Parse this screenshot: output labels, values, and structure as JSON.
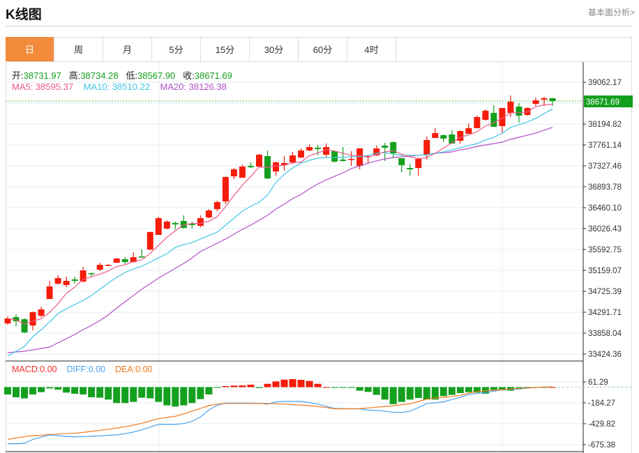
{
  "header": {
    "title": "K线图",
    "more_link": "基本面分析>"
  },
  "tabs": [
    {
      "label": "日",
      "active": true
    },
    {
      "label": "周"
    },
    {
      "label": "月"
    },
    {
      "label": "5分"
    },
    {
      "label": "15分"
    },
    {
      "label": "30分"
    },
    {
      "label": "60分"
    },
    {
      "label": "4时"
    }
  ],
  "ohlc_legend": {
    "open_label": "开:",
    "open": "38731.97",
    "high_label": "高:",
    "high": "38734.28",
    "low_label": "低:",
    "low": "38567.90",
    "close_label": "收:",
    "close": "38671.69"
  },
  "ma_legend": {
    "ma5": "MA5: 38595.37",
    "ma10": "MA10: 38510.22",
    "ma20": "MA20: 38126.38"
  },
  "macd_legend": {
    "macd": "MACD:0.00",
    "diff": "DIFF:0.00",
    "dea": "DEA:0.00"
  },
  "colors": {
    "up": "#f51c0a",
    "down": "#14a01e",
    "ma5": "#ea5a86",
    "ma10": "#3fc6e0",
    "ma20": "#b050c8",
    "diff": "#4aa3f0",
    "dea": "#f07a1e",
    "macd_label": "#f0302a",
    "accent": "#f28c3c"
  },
  "chart_data": [
    {
      "type": "candlestick",
      "current_price": "38671.69",
      "ylim": [
        33424.36,
        39062.17
      ],
      "y_ticks": [
        "39062.17",
        "38194.82",
        "37761.14",
        "37327.46",
        "36893.78",
        "36460.10",
        "36026.43",
        "35592.75",
        "35159.07",
        "34725.39",
        "34291.71",
        "33858.04",
        "33424.36"
      ],
      "y_tick_values": [
        39062.17,
        38194.82,
        37761.14,
        37327.46,
        36893.78,
        36460.1,
        36026.43,
        35592.75,
        35159.07,
        34725.39,
        34291.71,
        33858.04,
        33424.36
      ],
      "candles_ochl_order": "open,close,high,low",
      "candles": [
        [
          34060,
          34162,
          34205,
          34031
        ],
        [
          34190,
          34104,
          34248,
          34002
        ],
        [
          34147,
          33872,
          34162,
          33858
        ],
        [
          34017,
          34292,
          34306,
          33916
        ],
        [
          34219,
          34350,
          34407,
          34190
        ],
        [
          34566,
          34826,
          34942,
          34566
        ],
        [
          34884,
          35000,
          35058,
          34870
        ],
        [
          34856,
          34942,
          35029,
          34812
        ],
        [
          34971,
          34942,
          35029,
          34884
        ],
        [
          34928,
          35159,
          35231,
          34913
        ],
        [
          35101,
          35087,
          35116,
          35029
        ],
        [
          35174,
          35275,
          35318,
          35145
        ],
        [
          35260,
          35275,
          35289,
          35246
        ],
        [
          35318,
          35405,
          35419,
          35318
        ],
        [
          35390,
          35332,
          35434,
          35289
        ],
        [
          35332,
          35434,
          35535,
          35318
        ],
        [
          35448,
          35434,
          35593,
          35419
        ],
        [
          35592,
          35954,
          35968,
          35578
        ],
        [
          35896,
          36243,
          36272,
          35896
        ],
        [
          36026,
          36171,
          36200,
          36012
        ],
        [
          36142,
          36113,
          36171,
          36012
        ],
        [
          36185,
          36041,
          36301,
          36026
        ],
        [
          36128,
          36099,
          36171,
          36026
        ],
        [
          36084,
          36243,
          36301,
          36055
        ],
        [
          36257,
          36402,
          36431,
          36243
        ],
        [
          36431,
          36576,
          36605,
          36388
        ],
        [
          36590,
          37096,
          37111,
          36532
        ],
        [
          37111,
          37255,
          37284,
          37053
        ],
        [
          37082,
          37313,
          37356,
          37082
        ],
        [
          37327,
          37299,
          37400,
          37284
        ],
        [
          37313,
          37559,
          37574,
          37299
        ],
        [
          37530,
          37067,
          37646,
          37053
        ],
        [
          37212,
          37400,
          37415,
          37125
        ],
        [
          37342,
          37386,
          37530,
          37226
        ],
        [
          37400,
          37545,
          37617,
          37371
        ],
        [
          37501,
          37646,
          37690,
          37487
        ],
        [
          37646,
          37718,
          37776,
          37631
        ],
        [
          37704,
          37675,
          37762,
          37545
        ],
        [
          37559,
          37718,
          37791,
          37516
        ],
        [
          37631,
          37415,
          37646,
          37400
        ],
        [
          37458,
          37429,
          37718,
          37415
        ],
        [
          37458,
          37472,
          37631,
          37327
        ],
        [
          37327,
          37690,
          37690,
          37255
        ],
        [
          37516,
          37530,
          37559,
          37371
        ],
        [
          37545,
          37690,
          37747,
          37530
        ],
        [
          37747,
          37704,
          37805,
          37429
        ],
        [
          37819,
          37588,
          37834,
          37487
        ],
        [
          37487,
          37342,
          37487,
          37197
        ],
        [
          37284,
          37255,
          37371,
          37125
        ],
        [
          37284,
          37472,
          37501,
          37125
        ],
        [
          37559,
          37863,
          37935,
          37458
        ],
        [
          37906,
          38007,
          38109,
          37906
        ],
        [
          37964,
          37892,
          37978,
          37819
        ],
        [
          37978,
          37790,
          38065,
          37790
        ],
        [
          37848,
          38050,
          38065,
          37790
        ],
        [
          37993,
          38109,
          38210,
          37993
        ],
        [
          38109,
          38340,
          38369,
          38109
        ],
        [
          38282,
          38470,
          38499,
          38268
        ],
        [
          38427,
          38138,
          38585,
          38138
        ],
        [
          38152,
          38528,
          38528,
          38007
        ],
        [
          38427,
          38658,
          38788,
          38340
        ],
        [
          38557,
          38369,
          38629,
          38224
        ],
        [
          38383,
          38528,
          38542,
          38369
        ],
        [
          38614,
          38687,
          38744,
          38571
        ],
        [
          38701,
          38730,
          38759,
          38571
        ],
        [
          38731.97,
          38671.69,
          38734.28,
          38567.9
        ]
      ],
      "ma10": [
        33381,
        33482,
        33583,
        33786,
        33930,
        34089,
        34263,
        34364,
        34451,
        34537,
        34638,
        34769,
        34899,
        35015,
        35116,
        35188,
        35246,
        35332,
        35420,
        35506,
        35636,
        35694,
        35737,
        35810,
        35882,
        35954,
        36099,
        36243,
        36388,
        36489,
        36576,
        36720,
        36981,
        37154,
        37284,
        37386,
        37443,
        37487,
        37501,
        37501,
        37501,
        37516,
        37516,
        37545,
        37588,
        37602,
        37574,
        37545,
        37545,
        37545,
        37559,
        37588,
        37617,
        37660,
        37704,
        37747,
        37790,
        37863,
        37920,
        38007,
        38123,
        38181,
        38239,
        38311,
        38412,
        38510.22
      ],
      "ma20": [
        33453,
        33468,
        33482,
        33511,
        33540,
        33569,
        33656,
        33742,
        33829,
        33930,
        34017,
        34118,
        34234,
        34378,
        34508,
        34638,
        34769,
        34884,
        35000,
        35101,
        35202,
        35304,
        35420,
        35550,
        35636,
        35723,
        35810,
        35911,
        36012,
        36099,
        36200,
        36301,
        36431,
        36532,
        36648,
        36735,
        36850,
        36952,
        37038,
        37111,
        37183,
        37270,
        37327,
        37386,
        37429,
        37472,
        37501,
        37516,
        37530,
        37545,
        37559,
        37588,
        37602,
        37617,
        37660,
        37689,
        37732,
        37761,
        37790,
        37819,
        37877,
        37920,
        37964,
        38007,
        38065,
        38126.38
      ]
    },
    {
      "type": "macd",
      "ylim": [
        -675.38,
        61.29
      ],
      "y_ticks": [
        "61.29",
        "-184.27",
        "-429.82",
        "-675.38"
      ],
      "y_tick_values": [
        61.29,
        -184.27,
        -429.82,
        -675.38
      ],
      "histogram": [
        -86,
        -119,
        -132,
        -86,
        -59,
        -15,
        -29,
        -64,
        -78,
        -86,
        -119,
        -124,
        -146,
        -187,
        -187,
        -173,
        -124,
        -132,
        -173,
        -214,
        -228,
        -214,
        -187,
        -141,
        -86,
        -4,
        12,
        18,
        20,
        29,
        -10,
        39,
        67,
        88,
        94,
        86,
        72,
        39,
        0,
        -4,
        -4,
        -4,
        -42,
        -56,
        -91,
        -146,
        -200,
        -173,
        -146,
        -127,
        -146,
        -146,
        -105,
        -91,
        -70,
        -59,
        -64,
        -78,
        -31,
        -37,
        -42,
        -10,
        -10,
        -3,
        -3,
        0
      ],
      "diff": [
        -664,
        -664,
        -659,
        -615,
        -588,
        -563,
        -569,
        -580,
        -583,
        -580,
        -577,
        -572,
        -566,
        -561,
        -547,
        -528,
        -501,
        -468,
        -438,
        -438,
        -438,
        -427,
        -402,
        -351,
        -269,
        -214,
        -187,
        -187,
        -187,
        -187,
        -190,
        -200,
        -173,
        -168,
        -168,
        -168,
        -181,
        -200,
        -225,
        -250,
        -252,
        -255,
        -255,
        -269,
        -274,
        -282,
        -296,
        -299,
        -282,
        -241,
        -192,
        -184,
        -173,
        -146,
        -119,
        -86,
        -72,
        -64,
        -48,
        -29,
        -26,
        -23,
        -12,
        -4,
        1,
        4
      ],
      "dea": [
        -615,
        -596,
        -583,
        -569,
        -566,
        -555,
        -550,
        -544,
        -542,
        -531,
        -520,
        -506,
        -495,
        -481,
        -465,
        -446,
        -424,
        -397,
        -370,
        -356,
        -342,
        -315,
        -282,
        -250,
        -217,
        -200,
        -192,
        -192,
        -192,
        -192,
        -192,
        -192,
        -195,
        -200,
        -206,
        -211,
        -219,
        -228,
        -239,
        -255,
        -255,
        -255,
        -252,
        -244,
        -236,
        -228,
        -219,
        -206,
        -195,
        -168,
        -141,
        -127,
        -119,
        -110,
        -97,
        -70,
        -53,
        -42,
        -37,
        -29,
        -23,
        -15,
        -10,
        -4,
        1,
        4
      ]
    }
  ]
}
